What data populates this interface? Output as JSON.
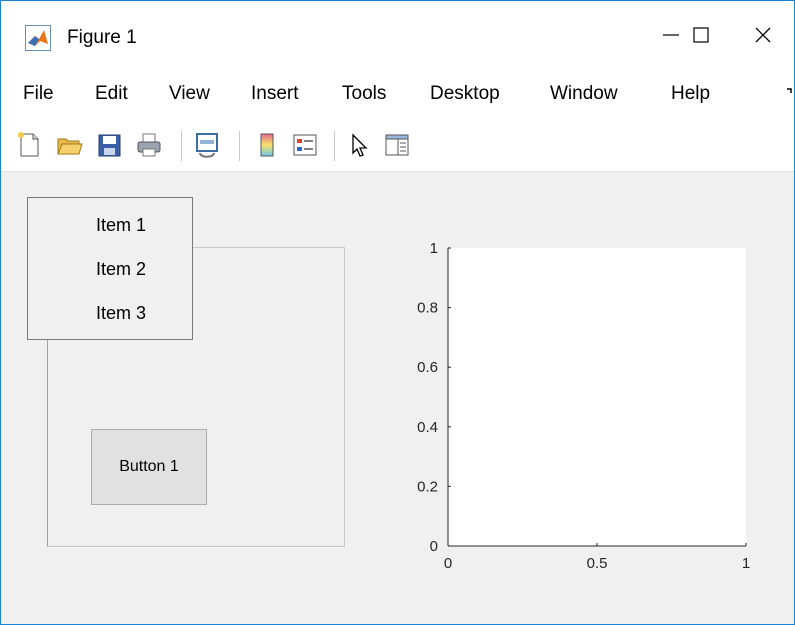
{
  "window": {
    "title": "Figure 1",
    "border_color": "#1883d7"
  },
  "menubar": {
    "items": [
      "File",
      "Edit",
      "View",
      "Insert",
      "Tools",
      "Desktop",
      "Window",
      "Help"
    ]
  },
  "toolbar": {
    "tools": [
      "new-figure-icon",
      "open-file-icon",
      "save-icon",
      "print-icon",
      "link-plot-icon",
      "colorbar-icon",
      "legend-icon",
      "edit-plot-arrow-icon",
      "property-inspector-icon"
    ]
  },
  "listbox": {
    "items": [
      "Item 1",
      "Item 2",
      "Item 3"
    ]
  },
  "button": {
    "label": "Button 1"
  },
  "axes": {
    "xticks": [
      "0",
      "0.5",
      "1"
    ],
    "yticks": [
      "0",
      "0.2",
      "0.4",
      "0.6",
      "0.8",
      "1"
    ],
    "xlim": [
      0,
      1
    ],
    "ylim": [
      0,
      1
    ]
  }
}
